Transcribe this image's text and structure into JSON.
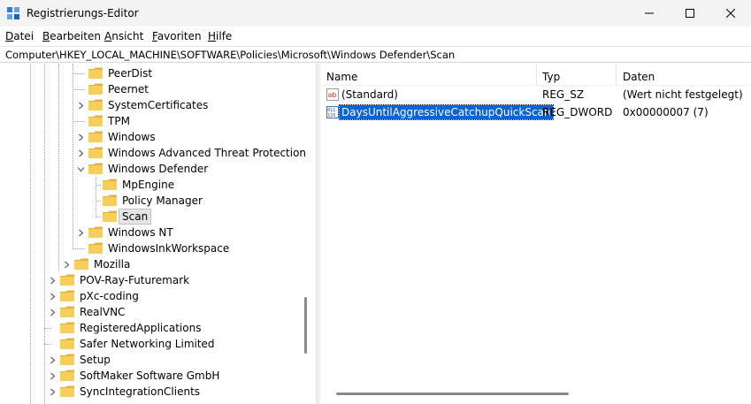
{
  "window": {
    "title": "Registrierungs-Editor",
    "icons": {
      "app": "registry-editor-icon",
      "minimize": "minimize-icon",
      "maximize": "maximize-icon",
      "close": "close-icon"
    }
  },
  "menu": [
    {
      "label": "Datei",
      "accel": "D",
      "rest": "atei"
    },
    {
      "label": "Bearbeiten",
      "accel": "B",
      "rest": "earbeiten"
    },
    {
      "label": "Ansicht",
      "accel": "A",
      "rest": "nsicht"
    },
    {
      "label": "Favoriten",
      "accel": "F",
      "rest": "avoriten"
    },
    {
      "label": "Hilfe",
      "accel": "H",
      "rest": "ilfe"
    }
  ],
  "address": {
    "path": "Computer\\HKEY_LOCAL_MACHINE\\SOFTWARE\\Policies\\Microsoft\\Windows Defender\\Scan"
  },
  "tree": {
    "nodes": [
      {
        "label": "PeerDist",
        "expander": "none"
      },
      {
        "label": "Peernet",
        "expander": "none"
      },
      {
        "label": "SystemCertificates",
        "expander": "collapsed"
      },
      {
        "label": "TPM",
        "expander": "none"
      },
      {
        "label": "Windows",
        "expander": "collapsed"
      },
      {
        "label": "Windows Advanced Threat Protection",
        "expander": "collapsed"
      },
      {
        "label": "Windows Defender",
        "expander": "expanded"
      },
      {
        "label": "MpEngine",
        "expander": "none"
      },
      {
        "label": "Policy Manager",
        "expander": "none"
      },
      {
        "label": "Scan",
        "expander": "none",
        "selected": true
      },
      {
        "label": "Windows NT",
        "expander": "collapsed"
      },
      {
        "label": "WindowsInkWorkspace",
        "expander": "none"
      },
      {
        "label": "Mozilla",
        "expander": "collapsed"
      },
      {
        "label": "POV-Ray-Futuremark",
        "expander": "collapsed"
      },
      {
        "label": "pXc-coding",
        "expander": "collapsed"
      },
      {
        "label": "RealVNC",
        "expander": "collapsed"
      },
      {
        "label": "RegisteredApplications",
        "expander": "none"
      },
      {
        "label": "Safer Networking Limited",
        "expander": "none"
      },
      {
        "label": "Setup",
        "expander": "collapsed"
      },
      {
        "label": "SoftMaker Software GmbH",
        "expander": "collapsed"
      },
      {
        "label": "SyncIntegrationClients",
        "expander": "collapsed"
      }
    ],
    "folder_color": "#f4c542"
  },
  "list": {
    "columns": {
      "name": "Name",
      "type": "Typ",
      "data": "Daten"
    },
    "rows": [
      {
        "icon": "string-value-icon",
        "name": "(Standard)",
        "type": "REG_SZ",
        "data": "(Wert nicht festgelegt)"
      },
      {
        "icon": "dword-value-icon",
        "name": "DaysUntilAggressiveCatchupQuickScan",
        "type": "REG_DWORD",
        "data": "0x00000007 (7)",
        "selected": true
      }
    ]
  },
  "colors": {
    "selection": "#0a64d8",
    "titlebar": "#f3f3f3"
  }
}
